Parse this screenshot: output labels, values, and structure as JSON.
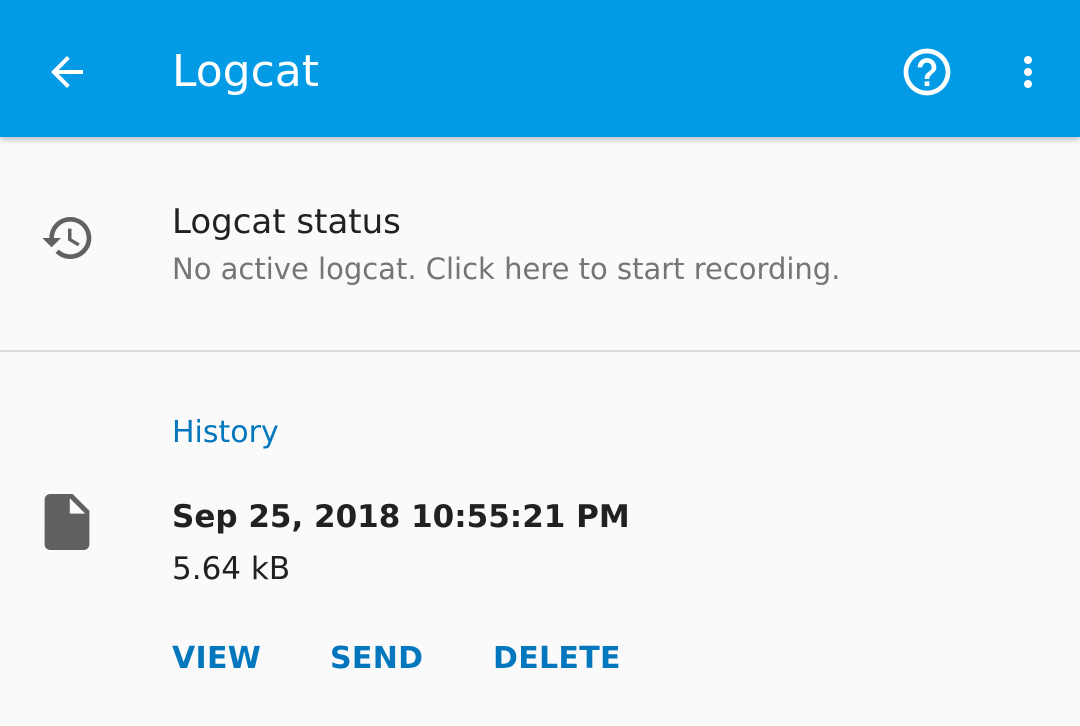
{
  "appbar": {
    "title": "Logcat",
    "background_color": "#039be5",
    "icons": {
      "back": "arrow-back-icon",
      "help": "help-circle-icon",
      "more": "more-vert-icon"
    }
  },
  "status": {
    "title": "Logcat status",
    "subtitle": "No active logcat. Click here to start recording.",
    "icon": "history-icon"
  },
  "history": {
    "header": "History",
    "items": [
      {
        "date": "Sep 25, 2018 10:55:21 PM",
        "size": "5.64 kB",
        "icon": "file-icon",
        "actions": {
          "view": "VIEW",
          "send": "SEND",
          "delete": "DELETE"
        }
      }
    ]
  },
  "colors": {
    "accent": "#0277bd",
    "primary_text": "#212121",
    "secondary_text": "#757575"
  }
}
